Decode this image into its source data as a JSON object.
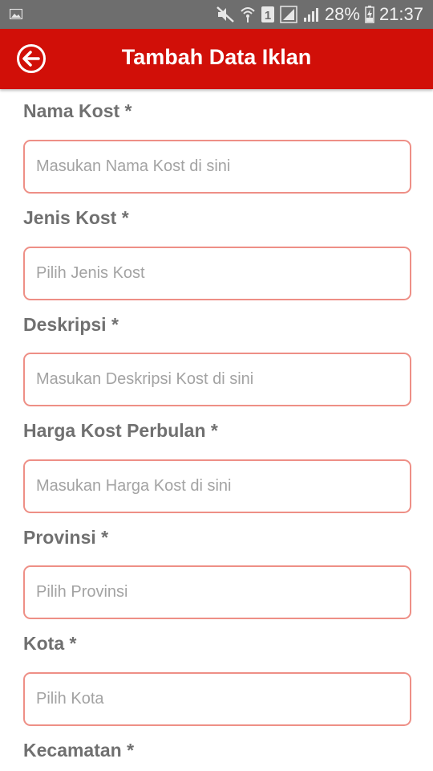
{
  "status_bar": {
    "battery": "28%",
    "time": "21:37",
    "sim_badge": "1",
    "icons": [
      "gallery-icon",
      "mute-icon",
      "wifi-icon",
      "sim-icon",
      "signal-icon",
      "signal-icon",
      "battery-charging-icon"
    ]
  },
  "header": {
    "title": "Tambah Data Iklan",
    "background": "#d10f08",
    "back_icon": "arrow-left-circle-icon"
  },
  "form": {
    "accent": "#ee8f86",
    "fields": [
      {
        "label": "Nama Kost *",
        "placeholder": "Masukan Nama Kost di sini",
        "value": ""
      },
      {
        "label": "Jenis Kost *",
        "placeholder": "Pilih Jenis Kost",
        "value": ""
      },
      {
        "label": "Deskripsi *",
        "placeholder": "Masukan Deskripsi Kost di sini",
        "value": ""
      },
      {
        "label": "Harga Kost Perbulan *",
        "placeholder": "Masukan Harga Kost di sini",
        "value": ""
      },
      {
        "label": "Provinsi *",
        "placeholder": "Pilih Provinsi",
        "value": ""
      },
      {
        "label": "Kota *",
        "placeholder": "Pilih Kota",
        "value": ""
      },
      {
        "label": "Kecamatan *"
      }
    ]
  }
}
